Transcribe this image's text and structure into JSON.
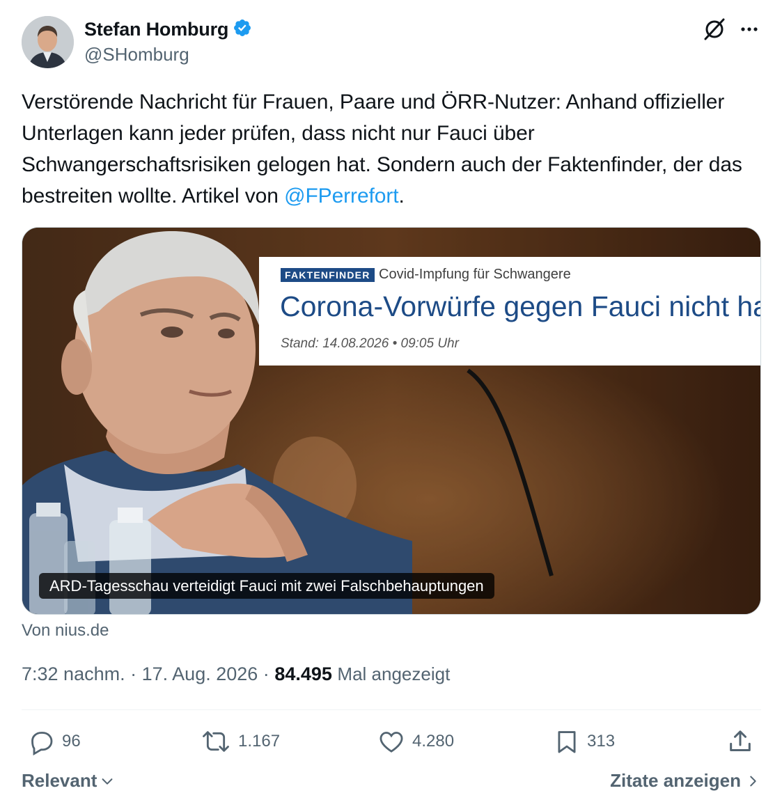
{
  "author": {
    "name": "Stefan Homburg",
    "handle": "@SHomburg",
    "verified": true,
    "icons": {
      "verified": "verified-badge-icon",
      "grok": "grok-icon",
      "more": "more-options-icon"
    }
  },
  "tweet": {
    "text_before_mention": "Verstörende Nachricht für Frauen, Paare und ÖRR-Nutzer: Anhand offizieller Unterlagen kann jeder prüfen, dass nicht nur Fauci über Schwangerschaftsrisiken gelogen hat. Sondern auch der Faktenfinder, der das bestreiten wollte. Artikel von ",
    "mention": "@FPerrefort",
    "text_after_mention": "."
  },
  "card": {
    "badge": "FAKTENFINDER",
    "topic": "Covid-Impfung für Schwangere",
    "headline": "Corona-Vorwürfe gegen Fauci nicht ha",
    "stand": "Stand: 14.08.2026 • 09:05 Uhr",
    "caption": "ARD-Tagesschau verteidigt Fauci mit zwei Falschbehauptungen",
    "source": "Von nius.de"
  },
  "meta": {
    "time": "7:32 nachm.",
    "separator": "·",
    "date": "17. Aug. 2026",
    "views_count": "84.495",
    "views_label": "Mal angezeigt"
  },
  "actions": {
    "replies": "96",
    "reposts": "1.167",
    "likes": "4.280",
    "bookmarks": "313"
  },
  "footer": {
    "sort_label": "Relevant",
    "quotes_label": "Zitate anzeigen"
  },
  "colors": {
    "accent": "#1d9bf0",
    "text": "#0f1419",
    "secondary": "#536471",
    "faktenfinder_blue": "#1d4b86"
  }
}
